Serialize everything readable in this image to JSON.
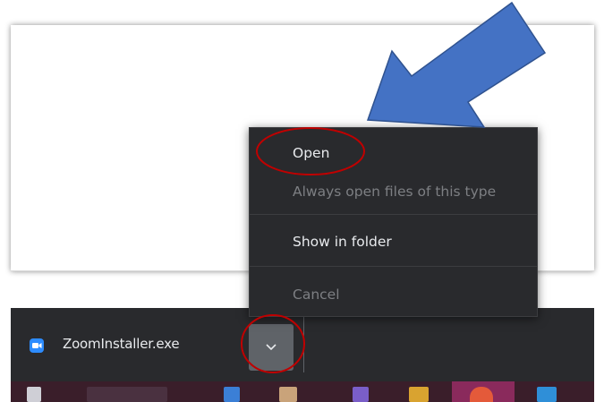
{
  "download_bar": {
    "file_name": "ZoomInstaller.exe",
    "file_icon": "zoom-camera-icon",
    "chevron_icon": "chevron-down-icon"
  },
  "context_menu": {
    "items": [
      {
        "label": "Open",
        "enabled": true
      },
      {
        "label": "Always open files of this type",
        "enabled": false
      },
      {
        "label": "Show in folder",
        "enabled": true
      },
      {
        "label": "Cancel",
        "enabled": false
      }
    ]
  },
  "annotations": {
    "arrow_color": "#4472c4",
    "circle_color": "#c00000"
  },
  "colors": {
    "download_bar_bg": "#292a2d",
    "menu_bg": "#292a2d",
    "menu_text": "#e8eaed",
    "menu_text_disabled": "#7d7f83",
    "chevron_button_bg": "#5f6368",
    "zoom_blue": "#2d8cff"
  }
}
